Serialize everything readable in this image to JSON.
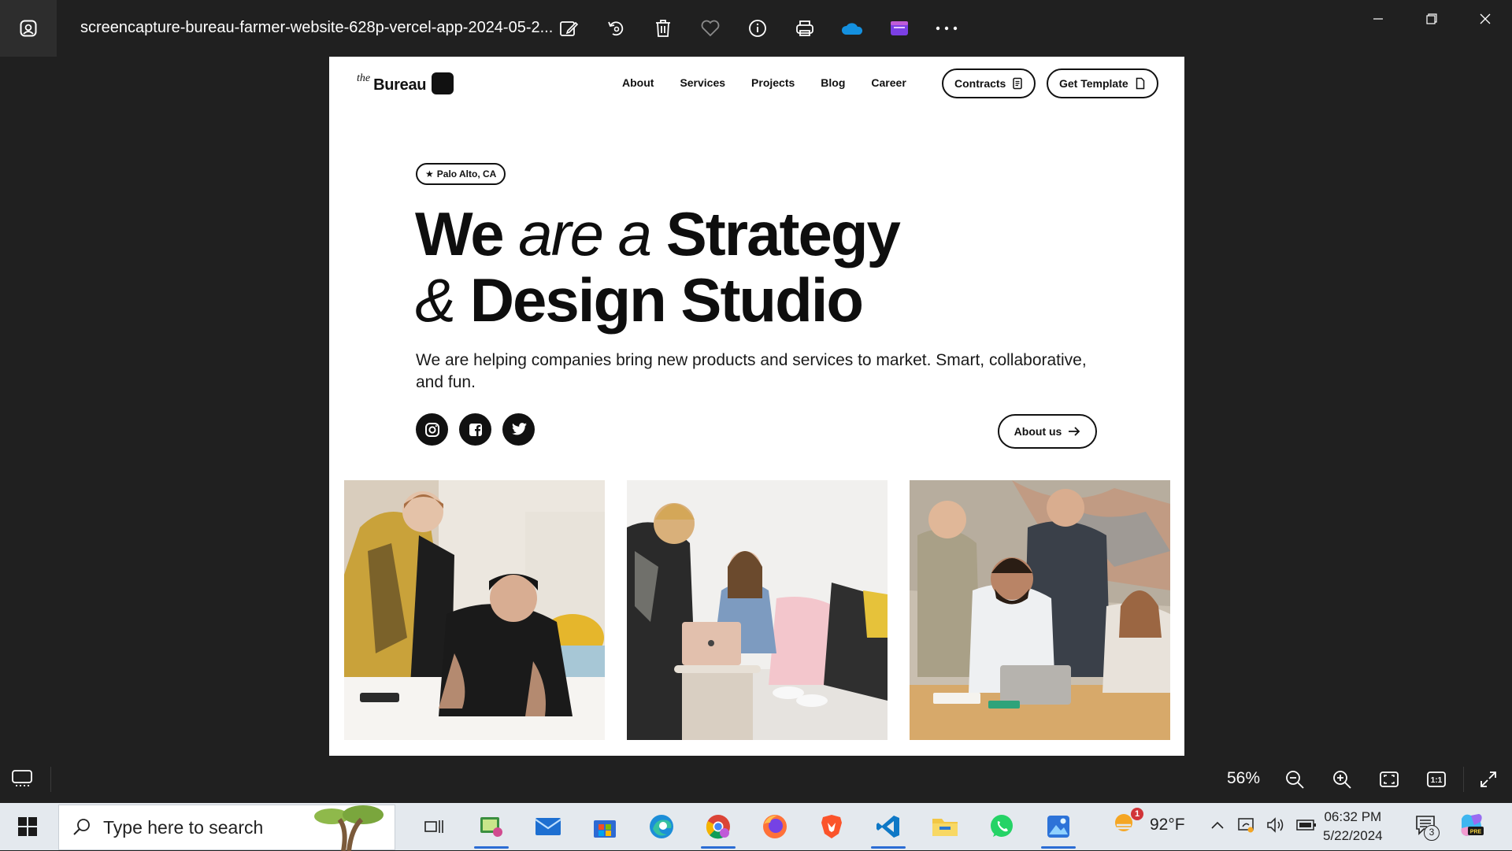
{
  "app": {
    "file_title": "screencapture-bureau-farmer-website-628p-vercel-app-2024-05-2..."
  },
  "site": {
    "logo_prefix": "the",
    "logo_word": "Bureau",
    "nav": [
      "About",
      "Services",
      "Projects",
      "Blog",
      "Career"
    ],
    "contracts_label": "Contracts",
    "template_label": "Get Template",
    "location": "Palo Alto, CA",
    "hero": {
      "w1": "We",
      "w2": "are a",
      "w3": "Strategy",
      "w4": "&",
      "w5": "Design Studio"
    },
    "lede": "We are helping companies bring new products and services to market. Smart, collaborative, and fun.",
    "about_label": "About us"
  },
  "viewer": {
    "zoom": "56%"
  },
  "taskbar": {
    "search_placeholder": "Type here to search",
    "temperature": "92°F",
    "weather_badge": "1",
    "time": "06:32 PM",
    "date": "5/22/2024",
    "notifications": "3"
  }
}
